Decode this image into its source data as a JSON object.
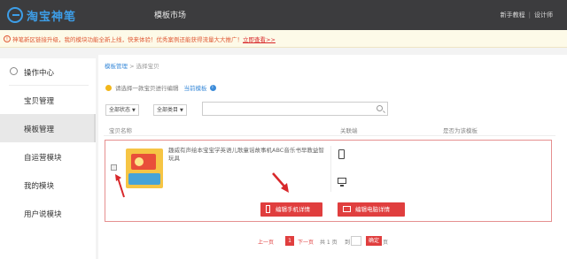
{
  "header": {
    "logo": "淘宝神笔",
    "center_title": "模板市场",
    "links": [
      "新手教程",
      "设计师"
    ]
  },
  "notice": {
    "text": "神笔新区链接升级，我的模块功能全新上线，快来体验！优秀案例还能获得流量大大推广！",
    "link": "立即查看>>"
  },
  "sidebar": {
    "heading": "操作中心",
    "items": [
      {
        "label": "宝贝管理",
        "active": false
      },
      {
        "label": "模板管理",
        "active": true
      },
      {
        "label": "自运营模块",
        "active": false
      },
      {
        "label": "我的模块",
        "active": false
      },
      {
        "label": "用户说模块",
        "active": false
      }
    ]
  },
  "breadcrumb": {
    "root": "模板管理",
    "sep": ">",
    "current": "选择宝贝"
  },
  "tip": {
    "text": "请选择一款宝贝进行编辑",
    "current_template": "当前模板"
  },
  "filters": {
    "status": "全部状态",
    "category": "全部类目"
  },
  "table": {
    "headers": [
      "宝贝名称",
      "关联端",
      "是否为该模板"
    ]
  },
  "product": {
    "title": "趣威有声绘本宝宝学英语儿歌童谣故事机ABC音乐书早教益智玩具",
    "edit_mobile": "编辑手机详情",
    "edit_pc": "编辑电脑详情"
  },
  "pager": {
    "prev": "上一页",
    "current_page": "1",
    "next": "下一页",
    "total": "共 1 页",
    "goto": "到",
    "confirm": "确定",
    "page_suffix": "页"
  },
  "colors": {
    "accent": "#e03e3e",
    "brand_blue": "#3d9ee8",
    "topbar": "#3c3c3e"
  }
}
